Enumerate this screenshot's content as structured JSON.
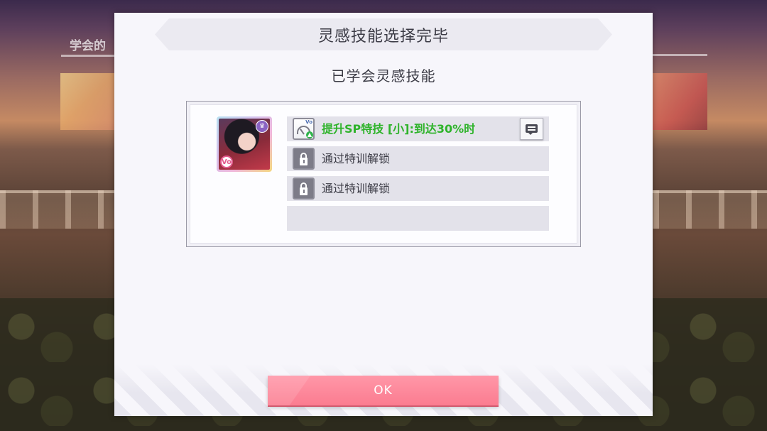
{
  "background": {
    "panel_title": "学会的",
    "accent_color": "#fb7c90"
  },
  "dialog": {
    "title": "灵感技能选择完毕",
    "subtitle": "已学会灵感技能",
    "card": {
      "attribute_badge": "Vo",
      "badge_icon": "crown-icon"
    },
    "skills": [
      {
        "label": "提升SP特技 [小]:到达30%时",
        "icon": "sp-gauge-icon",
        "icon_tag": "Vo",
        "status": "learned",
        "color": "#2eb32a"
      },
      {
        "label": "通过特训解锁",
        "icon": "lock-icon",
        "status": "locked"
      },
      {
        "label": "通过特训解锁",
        "icon": "lock-icon",
        "status": "locked"
      },
      {
        "label": "",
        "status": "empty"
      }
    ],
    "ok_label": "OK"
  }
}
